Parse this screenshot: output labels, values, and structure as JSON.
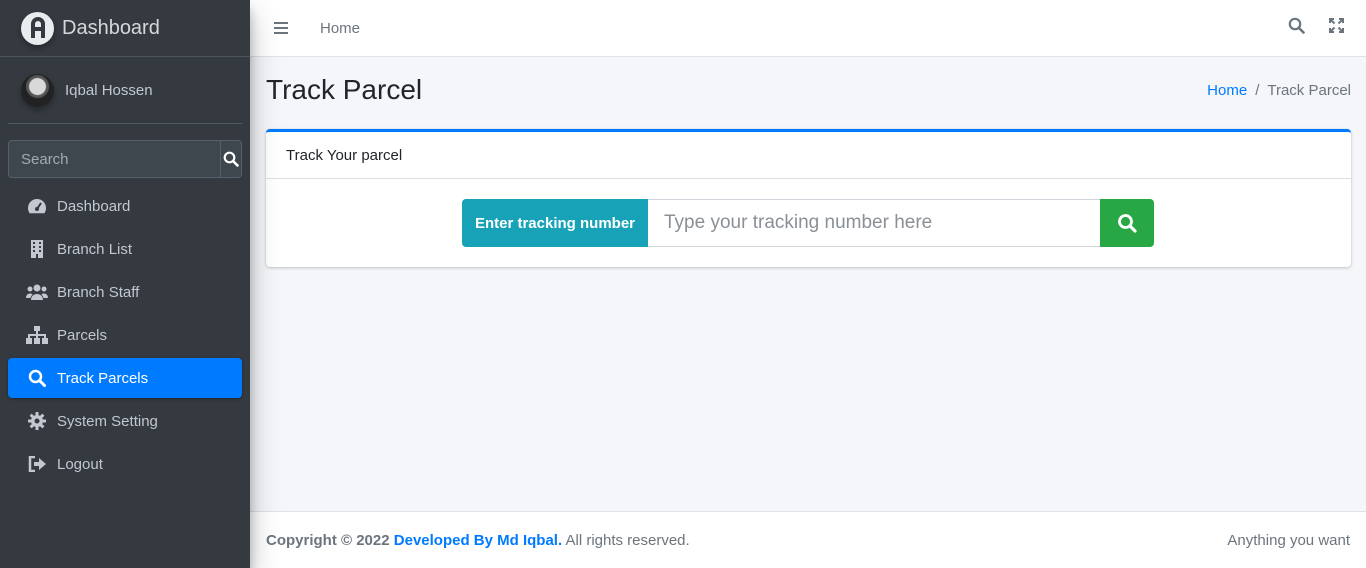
{
  "brand": {
    "name": "Dashboard",
    "logo_icon": "brand-logo-icon"
  },
  "user": {
    "name": "Iqbal Hossen"
  },
  "sidebar_search": {
    "placeholder": "Search"
  },
  "sidebar": {
    "items": [
      {
        "label": "Dashboard",
        "icon": "tachometer-icon",
        "active": false
      },
      {
        "label": "Branch List",
        "icon": "building-icon",
        "active": false
      },
      {
        "label": "Branch Staff",
        "icon": "users-icon",
        "active": false
      },
      {
        "label": "Parcels",
        "icon": "sitemap-icon",
        "active": false
      },
      {
        "label": "Track Parcels",
        "icon": "search-icon",
        "active": true
      },
      {
        "label": "System Setting",
        "icon": "gear-icon",
        "active": false
      },
      {
        "label": "Logout",
        "icon": "sign-out-icon",
        "active": false
      }
    ]
  },
  "navbar": {
    "home_label": "Home"
  },
  "page": {
    "title": "Track Parcel",
    "breadcrumb": {
      "home": "Home",
      "separator": "/",
      "current": "Track Parcel"
    }
  },
  "card": {
    "title": "Track Your parcel",
    "input_label": "Enter tracking number",
    "input_placeholder": "Type your tracking number here"
  },
  "footer": {
    "copyright": "Copyright © 2022",
    "developer": "Developed By Md Iqbal.",
    "rights": "All rights reserved.",
    "right_text": "Anything you want"
  },
  "colors": {
    "sidebar_bg": "#343a40",
    "primary": "#007bff",
    "info": "#17a2b8",
    "success": "#28a745"
  }
}
